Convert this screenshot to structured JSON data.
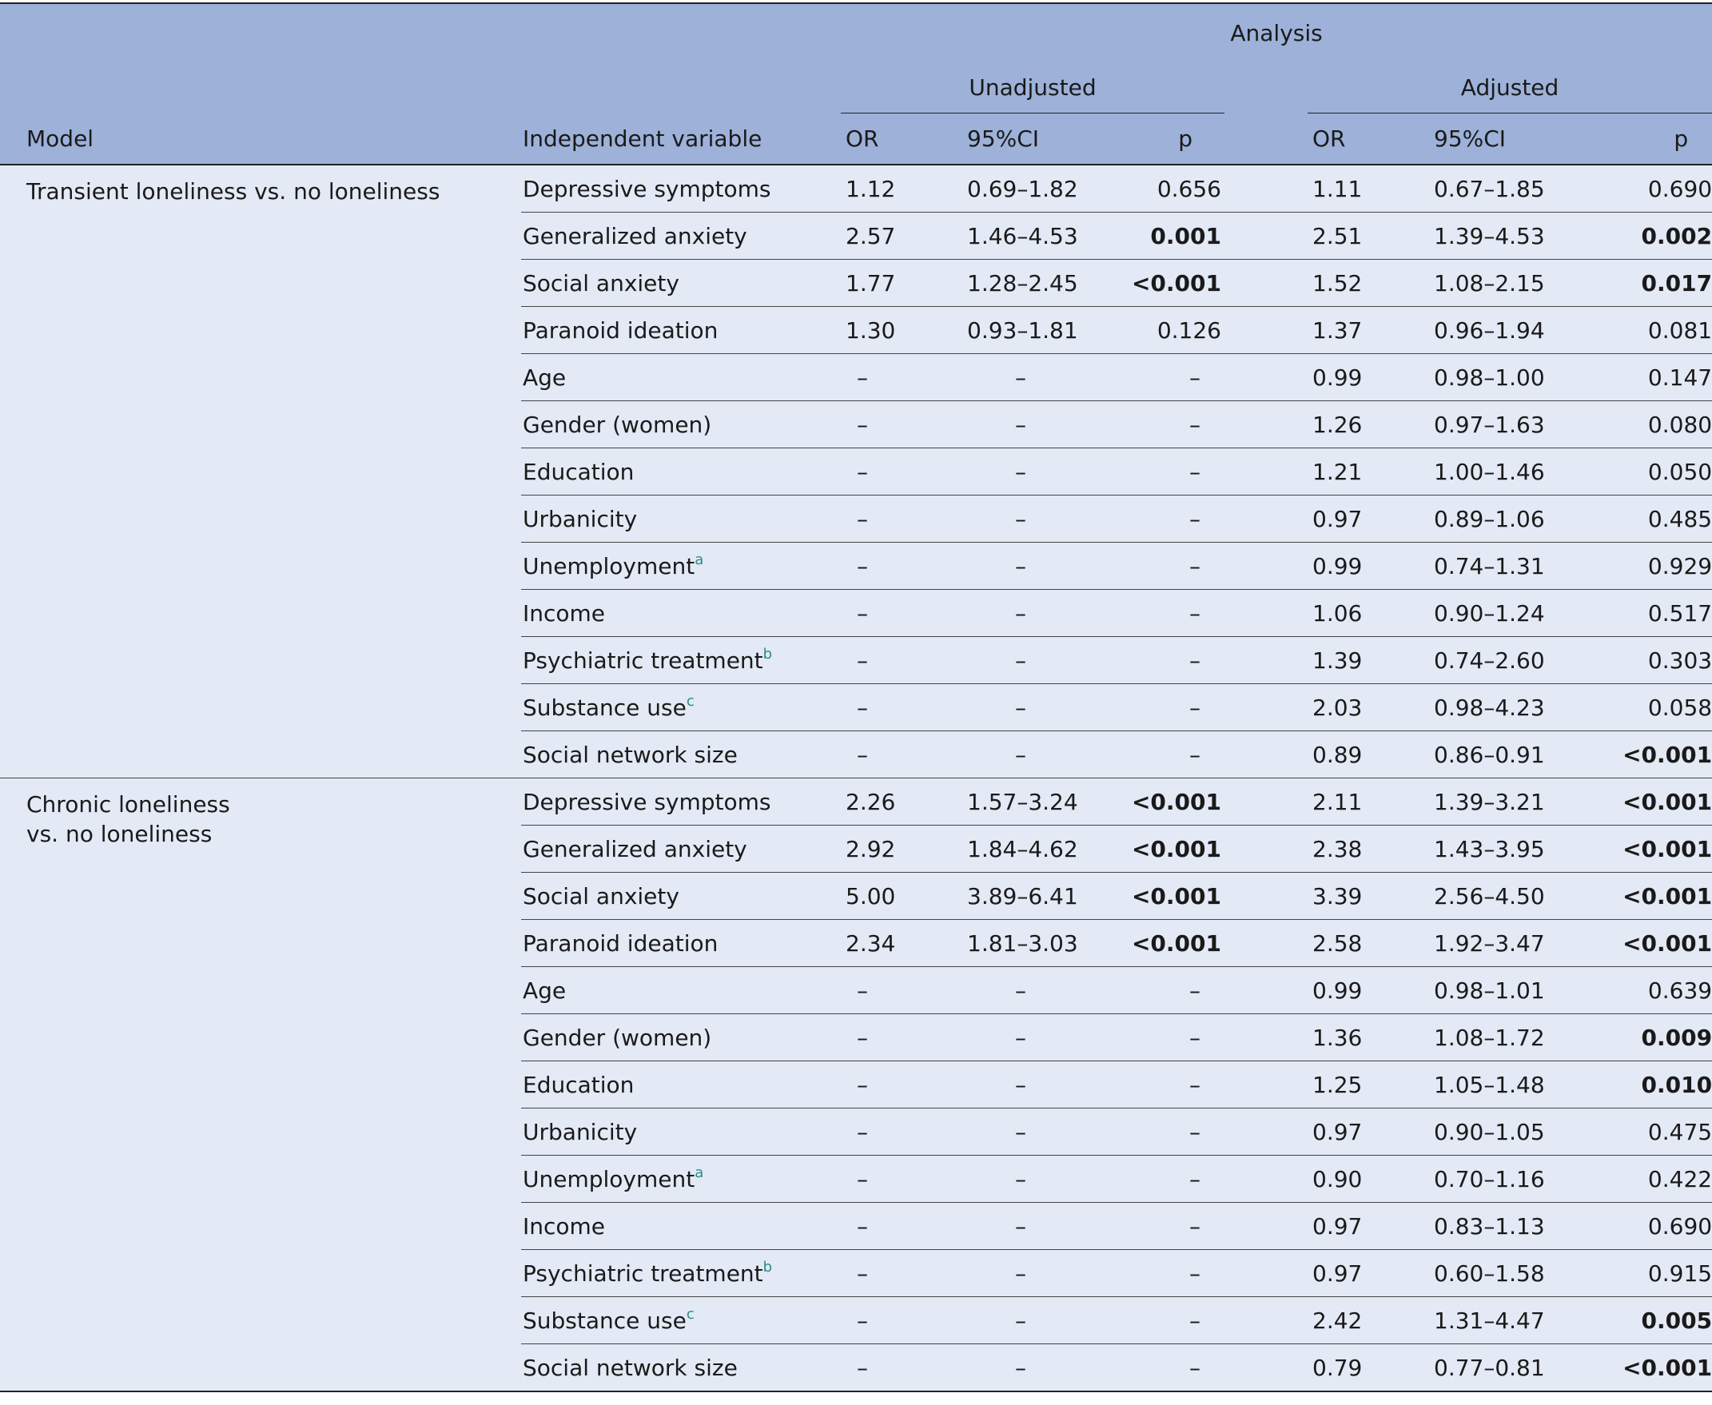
{
  "header": {
    "analysis": "Analysis",
    "unadjusted": "Unadjusted",
    "adjusted": "Adjusted",
    "model": "Model",
    "independent_variable": "Independent variable",
    "or": "OR",
    "ci": "95%CI",
    "p": "p"
  },
  "groups": [
    {
      "model_line1": "Transient loneliness vs. no loneliness",
      "model_line2": "",
      "rows": [
        {
          "var": "Depressive symptoms",
          "sup": "",
          "u_or": "1.12",
          "u_ci": "0.69–1.82",
          "u_p": "0.656",
          "u_p_bold": false,
          "a_or": "1.11",
          "a_ci": "0.67–1.85",
          "a_p": "0.690",
          "a_p_bold": false
        },
        {
          "var": "Generalized anxiety",
          "sup": "",
          "u_or": "2.57",
          "u_ci": "1.46–4.53",
          "u_p": "0.001",
          "u_p_bold": true,
          "a_or": "2.51",
          "a_ci": "1.39–4.53",
          "a_p": "0.002",
          "a_p_bold": true
        },
        {
          "var": "Social anxiety",
          "sup": "",
          "u_or": "1.77",
          "u_ci": "1.28–2.45",
          "u_p": "<0.001",
          "u_p_bold": true,
          "a_or": "1.52",
          "a_ci": "1.08–2.15",
          "a_p": "0.017",
          "a_p_bold": true
        },
        {
          "var": "Paranoid ideation",
          "sup": "",
          "u_or": "1.30",
          "u_ci": "0.93–1.81",
          "u_p": "0.126",
          "u_p_bold": false,
          "a_or": "1.37",
          "a_ci": "0.96–1.94",
          "a_p": "0.081",
          "a_p_bold": false
        },
        {
          "var": "Age",
          "sup": "",
          "u_or": "–",
          "u_ci": "–",
          "u_p": "–",
          "u_p_bold": false,
          "a_or": "0.99",
          "a_ci": "0.98–1.00",
          "a_p": "0.147",
          "a_p_bold": false
        },
        {
          "var": "Gender (women)",
          "sup": "",
          "u_or": "–",
          "u_ci": "–",
          "u_p": "–",
          "u_p_bold": false,
          "a_or": "1.26",
          "a_ci": "0.97–1.63",
          "a_p": "0.080",
          "a_p_bold": false
        },
        {
          "var": "Education",
          "sup": "",
          "u_or": "–",
          "u_ci": "–",
          "u_p": "–",
          "u_p_bold": false,
          "a_or": "1.21",
          "a_ci": "1.00–1.46",
          "a_p": "0.050",
          "a_p_bold": false
        },
        {
          "var": "Urbanicity",
          "sup": "",
          "u_or": "–",
          "u_ci": "–",
          "u_p": "–",
          "u_p_bold": false,
          "a_or": "0.97",
          "a_ci": "0.89–1.06",
          "a_p": "0.485",
          "a_p_bold": false
        },
        {
          "var": "Unemployment",
          "sup": "a",
          "u_or": "–",
          "u_ci": "–",
          "u_p": "–",
          "u_p_bold": false,
          "a_or": "0.99",
          "a_ci": "0.74–1.31",
          "a_p": "0.929",
          "a_p_bold": false
        },
        {
          "var": "Income",
          "sup": "",
          "u_or": "–",
          "u_ci": "–",
          "u_p": "–",
          "u_p_bold": false,
          "a_or": "1.06",
          "a_ci": "0.90–1.24",
          "a_p": "0.517",
          "a_p_bold": false
        },
        {
          "var": "Psychiatric treatment",
          "sup": "b",
          "u_or": "–",
          "u_ci": "–",
          "u_p": "–",
          "u_p_bold": false,
          "a_or": "1.39",
          "a_ci": "0.74–2.60",
          "a_p": "0.303",
          "a_p_bold": false
        },
        {
          "var": "Substance use",
          "sup": "c",
          "u_or": "–",
          "u_ci": "–",
          "u_p": "–",
          "u_p_bold": false,
          "a_or": "2.03",
          "a_ci": "0.98–4.23",
          "a_p": "0.058",
          "a_p_bold": false
        },
        {
          "var": "Social network size",
          "sup": "",
          "u_or": "–",
          "u_ci": "–",
          "u_p": "–",
          "u_p_bold": false,
          "a_or": "0.89",
          "a_ci": "0.86–0.91",
          "a_p": "<0.001",
          "a_p_bold": true
        }
      ]
    },
    {
      "model_line1": "Chronic loneliness",
      "model_line2": "vs. no loneliness",
      "rows": [
        {
          "var": "Depressive symptoms",
          "sup": "",
          "u_or": "2.26",
          "u_ci": "1.57–3.24",
          "u_p": "<0.001",
          "u_p_bold": true,
          "a_or": "2.11",
          "a_ci": "1.39–3.21",
          "a_p": "<0.001",
          "a_p_bold": true
        },
        {
          "var": "Generalized anxiety",
          "sup": "",
          "u_or": "2.92",
          "u_ci": "1.84–4.62",
          "u_p": "<0.001",
          "u_p_bold": true,
          "a_or": "2.38",
          "a_ci": "1.43–3.95",
          "a_p": "<0.001",
          "a_p_bold": true
        },
        {
          "var": "Social anxiety",
          "sup": "",
          "u_or": "5.00",
          "u_ci": "3.89–6.41",
          "u_p": "<0.001",
          "u_p_bold": true,
          "a_or": "3.39",
          "a_ci": "2.56–4.50",
          "a_p": "<0.001",
          "a_p_bold": true
        },
        {
          "var": "Paranoid ideation",
          "sup": "",
          "u_or": "2.34",
          "u_ci": "1.81–3.03",
          "u_p": "<0.001",
          "u_p_bold": true,
          "a_or": "2.58",
          "a_ci": "1.92–3.47",
          "a_p": "<0.001",
          "a_p_bold": true
        },
        {
          "var": "Age",
          "sup": "",
          "u_or": "–",
          "u_ci": "–",
          "u_p": "–",
          "u_p_bold": false,
          "a_or": "0.99",
          "a_ci": "0.98–1.01",
          "a_p": "0.639",
          "a_p_bold": false
        },
        {
          "var": "Gender (women)",
          "sup": "",
          "u_or": "–",
          "u_ci": "–",
          "u_p": "–",
          "u_p_bold": false,
          "a_or": "1.36",
          "a_ci": "1.08–1.72",
          "a_p": "0.009",
          "a_p_bold": true
        },
        {
          "var": "Education",
          "sup": "",
          "u_or": "–",
          "u_ci": "–",
          "u_p": "–",
          "u_p_bold": false,
          "a_or": "1.25",
          "a_ci": "1.05–1.48",
          "a_p": "0.010",
          "a_p_bold": true
        },
        {
          "var": "Urbanicity",
          "sup": "",
          "u_or": "–",
          "u_ci": "–",
          "u_p": "–",
          "u_p_bold": false,
          "a_or": "0.97",
          "a_ci": "0.90–1.05",
          "a_p": "0.475",
          "a_p_bold": false
        },
        {
          "var": "Unemployment",
          "sup": "a",
          "u_or": "–",
          "u_ci": "–",
          "u_p": "–",
          "u_p_bold": false,
          "a_or": "0.90",
          "a_ci": "0.70–1.16",
          "a_p": "0.422",
          "a_p_bold": false
        },
        {
          "var": "Income",
          "sup": "",
          "u_or": "–",
          "u_ci": "–",
          "u_p": "–",
          "u_p_bold": false,
          "a_or": "0.97",
          "a_ci": "0.83–1.13",
          "a_p": "0.690",
          "a_p_bold": false
        },
        {
          "var": "Psychiatric treatment",
          "sup": "b",
          "u_or": "–",
          "u_ci": "–",
          "u_p": "–",
          "u_p_bold": false,
          "a_or": "0.97",
          "a_ci": "0.60–1.58",
          "a_p": "0.915",
          "a_p_bold": false
        },
        {
          "var": "Substance use",
          "sup": "c",
          "u_or": "–",
          "u_ci": "–",
          "u_p": "–",
          "u_p_bold": false,
          "a_or": "2.42",
          "a_ci": "1.31–4.47",
          "a_p": "0.005",
          "a_p_bold": true
        },
        {
          "var": "Social network size",
          "sup": "",
          "u_or": "–",
          "u_ci": "–",
          "u_p": "–",
          "u_p_bold": false,
          "a_or": "0.79",
          "a_ci": "0.77–0.81",
          "a_p": "<0.001",
          "a_p_bold": true
        }
      ]
    }
  ]
}
